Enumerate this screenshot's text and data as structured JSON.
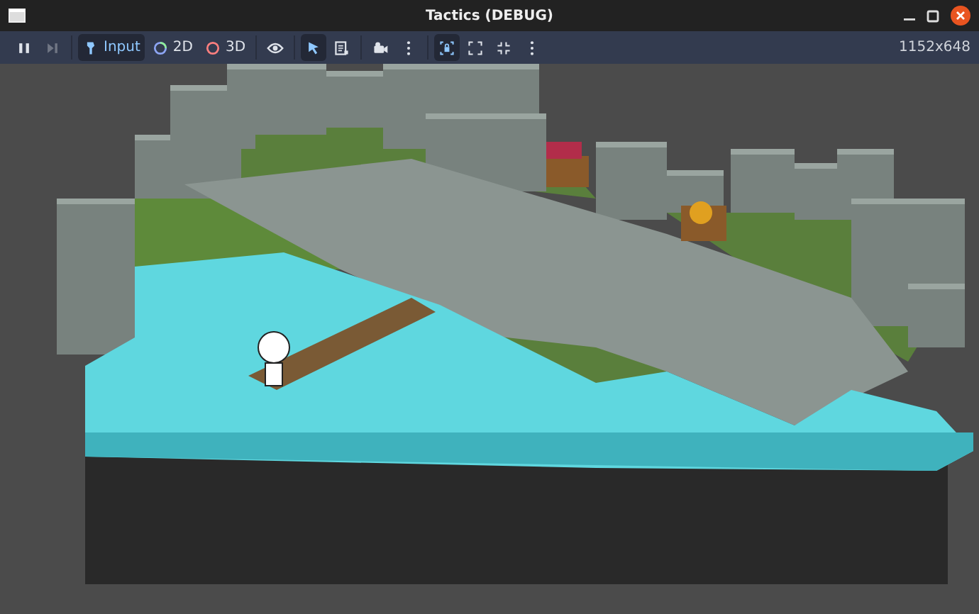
{
  "window": {
    "title": "Tactics (DEBUG)"
  },
  "toolbar": {
    "groups": [
      [
        {
          "kind": "pause",
          "selected": false,
          "disabled": false
        },
        {
          "kind": "step",
          "selected": false,
          "disabled": true
        }
      ],
      [
        {
          "kind": "input",
          "label": "Input",
          "selected": true,
          "disabled": false
        },
        {
          "kind": "mode-2d",
          "label": "2D",
          "selected": false,
          "disabled": false
        },
        {
          "kind": "mode-3d",
          "label": "3D",
          "selected": false,
          "disabled": false
        }
      ],
      [
        {
          "kind": "visibility",
          "selected": false,
          "disabled": false
        }
      ],
      [
        {
          "kind": "select",
          "selected": true,
          "disabled": false
        },
        {
          "kind": "list",
          "selected": false,
          "disabled": false
        }
      ],
      [
        {
          "kind": "camera",
          "selected": false,
          "disabled": false
        },
        {
          "kind": "more",
          "selected": false,
          "disabled": false
        }
      ],
      [
        {
          "kind": "lock-camera",
          "selected": true,
          "disabled": false
        },
        {
          "kind": "expand",
          "selected": false,
          "disabled": false
        },
        {
          "kind": "shrink",
          "selected": false,
          "disabled": false
        },
        {
          "kind": "more",
          "selected": false,
          "disabled": false
        }
      ]
    ],
    "resolution": "1152x648"
  }
}
